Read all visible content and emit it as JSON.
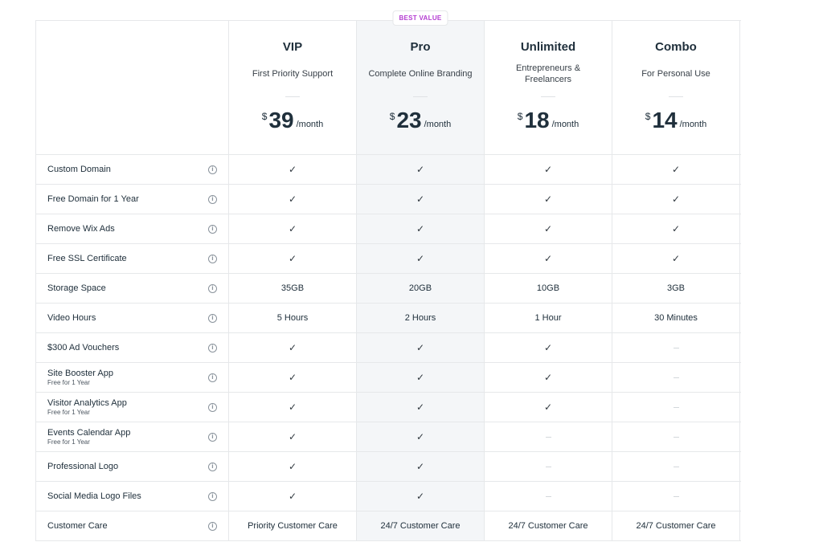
{
  "badge": "BEST VALUE",
  "plans": [
    {
      "name": "VIP",
      "tagline": "First Priority Support",
      "currency": "$",
      "price": "39",
      "period": "/month",
      "highlight": false
    },
    {
      "name": "Pro",
      "tagline": "Complete Online Branding",
      "currency": "$",
      "price": "23",
      "period": "/month",
      "highlight": true
    },
    {
      "name": "Unlimited",
      "tagline": "Entrepreneurs & Freelancers",
      "currency": "$",
      "price": "18",
      "period": "/month",
      "highlight": false
    },
    {
      "name": "Combo",
      "tagline": "For Personal Use",
      "currency": "$",
      "price": "14",
      "period": "/month",
      "highlight": false
    }
  ],
  "features": [
    {
      "label": "Custom Domain",
      "sub": "",
      "values": [
        "check",
        "check",
        "check",
        "check"
      ]
    },
    {
      "label": "Free Domain for 1 Year",
      "sub": "",
      "values": [
        "check",
        "check",
        "check",
        "check"
      ]
    },
    {
      "label": "Remove Wix Ads",
      "sub": "",
      "values": [
        "check",
        "check",
        "check",
        "check"
      ]
    },
    {
      "label": "Free SSL Certificate",
      "sub": "",
      "values": [
        "check",
        "check",
        "check",
        "check"
      ]
    },
    {
      "label": "Storage Space",
      "sub": "",
      "values": [
        "35GB",
        "20GB",
        "10GB",
        "3GB"
      ]
    },
    {
      "label": "Video Hours",
      "sub": "",
      "values": [
        "5 Hours",
        "2 Hours",
        "1 Hour",
        "30 Minutes"
      ]
    },
    {
      "label": "$300 Ad Vouchers",
      "sub": "",
      "values": [
        "check",
        "check",
        "check",
        "none"
      ]
    },
    {
      "label": "Site Booster App",
      "sub": "Free for 1 Year",
      "values": [
        "check",
        "check",
        "check",
        "none"
      ]
    },
    {
      "label": "Visitor Analytics App",
      "sub": "Free for 1 Year",
      "values": [
        "check",
        "check",
        "check",
        "none"
      ]
    },
    {
      "label": "Events Calendar App",
      "sub": "Free for 1 Year",
      "values": [
        "check",
        "check",
        "none",
        "none"
      ]
    },
    {
      "label": "Professional Logo",
      "sub": "",
      "values": [
        "check",
        "check",
        "none",
        "none"
      ]
    },
    {
      "label": "Social Media Logo Files",
      "sub": "",
      "values": [
        "check",
        "check",
        "none",
        "none"
      ]
    },
    {
      "label": "Customer Care",
      "sub": "",
      "values": [
        "Priority Customer Care",
        "24/7 Customer Care",
        "24/7 Customer Care",
        "24/7 Customer Care"
      ]
    }
  ],
  "icons": {
    "info": "info-icon",
    "check": "check-icon",
    "none": "dash-icon"
  },
  "colors": {
    "badge_text": "#b33bd1",
    "highlight_bg": "#f4f6f8",
    "border": "#e6e8ea"
  }
}
